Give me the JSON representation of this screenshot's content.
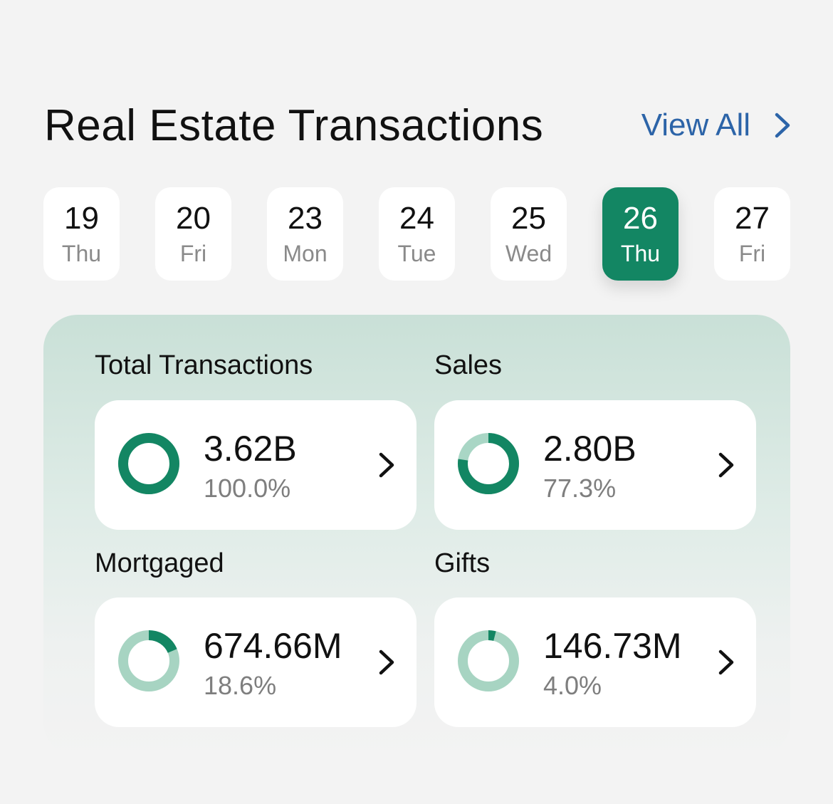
{
  "header": {
    "title": "Real Estate Transactions",
    "view_all_label": "View All",
    "view_all_icon": "chevron-right-icon"
  },
  "dates": [
    {
      "day": "19",
      "weekday": "Thu",
      "selected": false
    },
    {
      "day": "20",
      "weekday": "Fri",
      "selected": false
    },
    {
      "day": "23",
      "weekday": "Mon",
      "selected": false
    },
    {
      "day": "24",
      "weekday": "Tue",
      "selected": false
    },
    {
      "day": "25",
      "weekday": "Wed",
      "selected": false
    },
    {
      "day": "26",
      "weekday": "Thu",
      "selected": true
    },
    {
      "day": "27",
      "weekday": "Fri",
      "selected": false
    }
  ],
  "stats": [
    {
      "label": "Total Transactions",
      "value": "3.62B",
      "percent": "100.0%",
      "fraction": 1.0,
      "style": "dark"
    },
    {
      "label": "Sales",
      "value": "2.80B",
      "percent": "77.3%",
      "fraction": 0.773,
      "style": "dark"
    },
    {
      "label": "Mortgaged",
      "value": "674.66M",
      "percent": "18.6%",
      "fraction": 0.186,
      "style": "light"
    },
    {
      "label": "Gifts",
      "value": "146.73M",
      "percent": "4.0%",
      "fraction": 0.04,
      "style": "light"
    }
  ],
  "colors": {
    "accent_green": "#138663",
    "ring_track_dark": "#a9d6c5",
    "ring_track_light": "#a7d4c2",
    "link_blue": "#2c64a8"
  }
}
